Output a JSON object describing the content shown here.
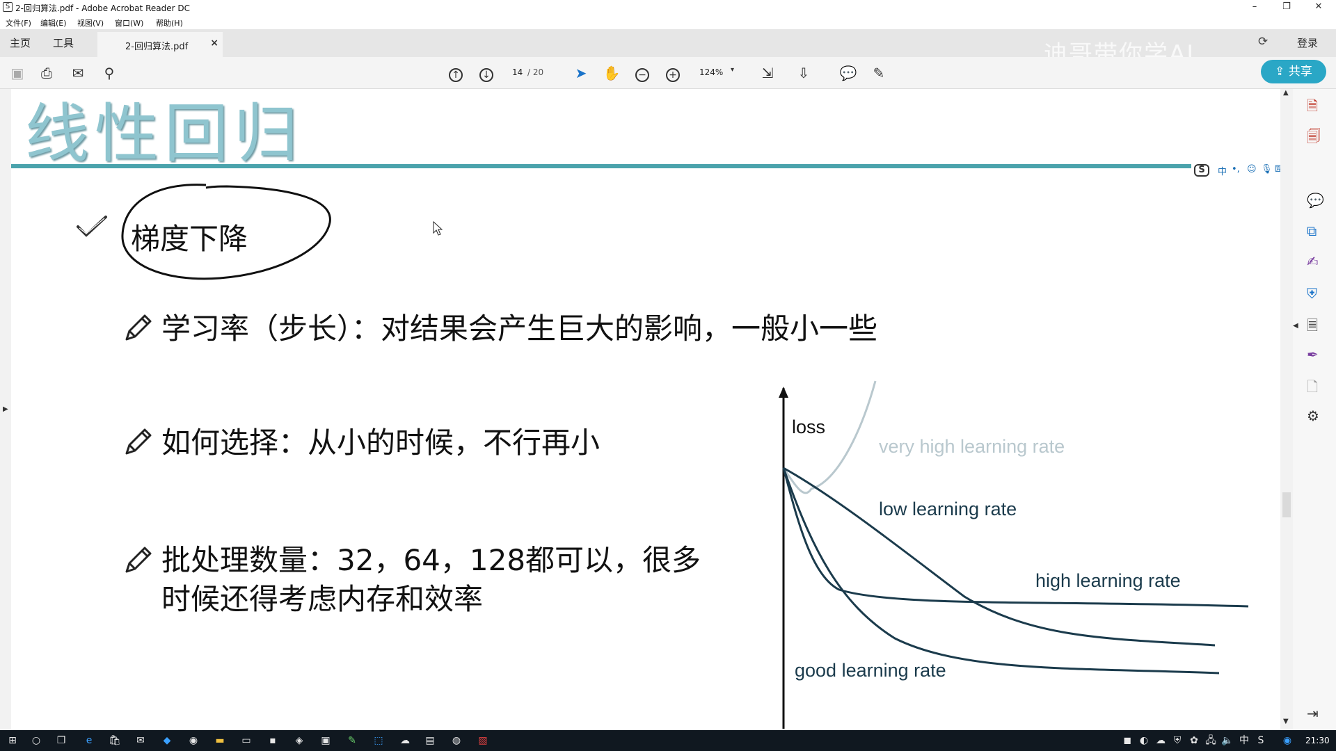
{
  "window": {
    "title": "2-回归算法.pdf - Adobe Acrobat Reader DC",
    "minimize": "–",
    "restore": "❐",
    "close": "✕"
  },
  "menu": [
    "文件(F)",
    "编辑(E)",
    "视图(V)",
    "窗口(W)",
    "帮助(H)"
  ],
  "tabs": {
    "home": "主页",
    "tools": "工具",
    "document": "2-回归算法.pdf",
    "close_tab": "×",
    "sign_in": "登录",
    "watermark": "迪哥带你学AI"
  },
  "toolbar": {
    "current_page": "14",
    "total_pages": "/ 20",
    "zoom": "124%",
    "share": "共享"
  },
  "slide": {
    "title": "线性回归",
    "topic": "梯度下降",
    "bullets": [
      "学习率（步长）：对结果会产生巨大的影响，一般小一些",
      "如何选择：从小的时候，不行再小",
      "批处理数量：32，64，128都可以，很多",
      "时候还得考虑内存和效率"
    ]
  },
  "chart_data": {
    "type": "line",
    "ylabel": "loss",
    "series": [
      {
        "name": "very high learning rate",
        "color": "#b9c8ce"
      },
      {
        "name": "low learning rate",
        "color": "#1b3b4c"
      },
      {
        "name": "high learning rate",
        "color": "#1b3b4c"
      },
      {
        "name": "good learning rate",
        "color": "#1b3b4c"
      }
    ]
  },
  "ime": {
    "lang": "中",
    "punct": "•,"
  },
  "taskbar": {
    "clock": "21:30"
  },
  "colors": {
    "title": "#8fc5cf",
    "rule": "#4aa3ac",
    "share": "#2aa7c6",
    "taskbar": "#101820"
  }
}
